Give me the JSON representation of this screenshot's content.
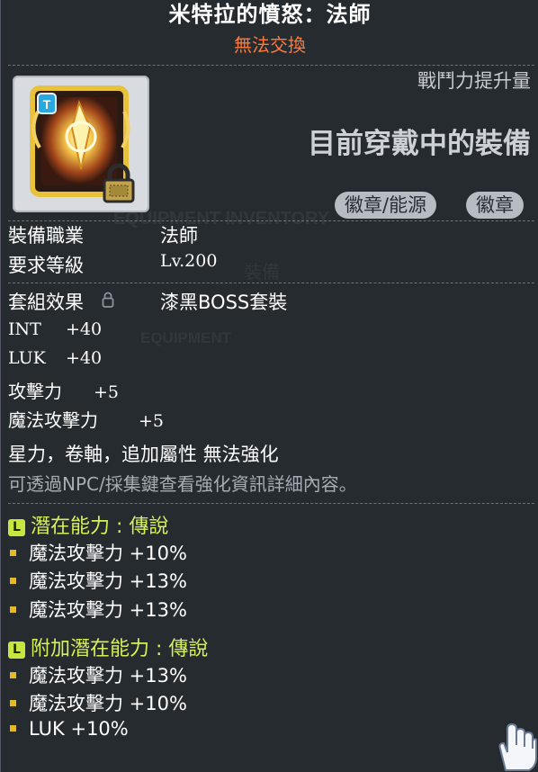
{
  "item": {
    "name": "米特拉的憤怒：法師",
    "trade_status": "無法交換",
    "power_up_label": "戰鬥力提升量",
    "equipped_label": "目前穿戴中的裝備",
    "tags": [
      "徽章/能源",
      "徽章"
    ]
  },
  "background": {
    "inventory_title": "EQUIPMENT INVENTORY",
    "equipment_tab": "裝備",
    "equipment_label": "EQUIPMENT"
  },
  "requirements": {
    "job_label": "裝備職業",
    "job_value": "法師",
    "level_label": "要求等級",
    "level_value": "Lv.200",
    "set_label": "套組效果",
    "set_value": "漆黑BOSS套裝"
  },
  "stats": [
    {
      "name": "INT",
      "value": "+40"
    },
    {
      "name": "LUK",
      "value": "+40"
    },
    {
      "name": "攻擊力",
      "value": "+5"
    },
    {
      "name": "魔法攻擊力",
      "value": "+5"
    }
  ],
  "notes": {
    "no_enhance": "星力，卷軸，追加屬性 無法強化",
    "npc_hint": "可透過NPC/採集鍵查看強化資訊詳細內容。"
  },
  "potential": {
    "badge": "L",
    "title": "潛在能力 : 傳說",
    "lines": [
      "魔法攻擊力 +10%",
      "魔法攻擊力 +13%",
      "魔法攻擊力 +13%"
    ]
  },
  "bonus_potential": {
    "badge": "L",
    "title": "附加潛在能力 : 傳說",
    "lines": [
      "魔法攻擊力 +13%",
      "魔法攻擊力 +10%",
      "LUK +10%"
    ]
  },
  "colors": {
    "title": "#ffffff",
    "trade_status": "#ff7a3a",
    "potential": "#d6f05a",
    "bullet": "#e8b820"
  },
  "icons": {
    "item": "mitra-rage-emblem-icon",
    "lock": "lock-icon",
    "set_lock": "small-lock-icon",
    "cursor": "glove-cursor-icon"
  }
}
